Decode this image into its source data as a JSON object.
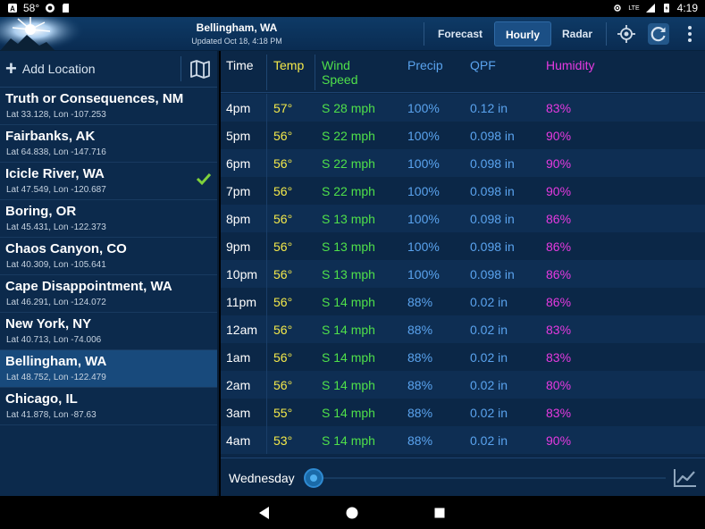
{
  "status_bar": {
    "temperature": "58°",
    "time": "4:19",
    "network": "LTE"
  },
  "header": {
    "title": "Bellingham, WA",
    "subtitle": "Updated Oct 18, 4:18 PM",
    "tabs": [
      {
        "label": "Forecast",
        "active": false
      },
      {
        "label": "Hourly",
        "active": true
      },
      {
        "label": "Radar",
        "active": false
      }
    ],
    "icons": [
      "locate-icon",
      "refresh-icon",
      "overflow-menu-icon"
    ]
  },
  "sidebar": {
    "add_label": "Add Location",
    "locations": [
      {
        "name": "Truth or Consequences, NM",
        "coords": "Lat 33.128, Lon -107.253",
        "checked": false,
        "selected": false
      },
      {
        "name": "Fairbanks, AK",
        "coords": "Lat 64.838, Lon -147.716",
        "checked": false,
        "selected": false
      },
      {
        "name": "Icicle River, WA",
        "coords": "Lat 47.549, Lon -120.687",
        "checked": true,
        "selected": false
      },
      {
        "name": "Boring, OR",
        "coords": "Lat 45.431, Lon -122.373",
        "checked": false,
        "selected": false
      },
      {
        "name": "Chaos Canyon, CO",
        "coords": "Lat 40.309, Lon -105.641",
        "checked": false,
        "selected": false
      },
      {
        "name": "Cape Disappointment, WA",
        "coords": "Lat 46.291, Lon -124.072",
        "checked": false,
        "selected": false
      },
      {
        "name": "New York, NY",
        "coords": "Lat 40.713, Lon -74.006",
        "checked": false,
        "selected": false
      },
      {
        "name": "Bellingham, WA",
        "coords": "Lat 48.752, Lon -122.479",
        "checked": false,
        "selected": true
      },
      {
        "name": "Chicago, IL",
        "coords": "Lat 41.878, Lon -87.63",
        "checked": false,
        "selected": false
      }
    ]
  },
  "table": {
    "headers": {
      "time": "Time",
      "temp": "Temp",
      "wind_line1": "Wind",
      "wind_line2": "Speed",
      "precip": "Precip",
      "qpf": "QPF",
      "humidity": "Humidity"
    },
    "rows": [
      {
        "time": "4pm",
        "temp": "57°",
        "wind": "S 28 mph",
        "precip": "100%",
        "qpf": "0.12 in",
        "humidity": "83%"
      },
      {
        "time": "5pm",
        "temp": "56°",
        "wind": "S 22 mph",
        "precip": "100%",
        "qpf": "0.098 in",
        "humidity": "90%"
      },
      {
        "time": "6pm",
        "temp": "56°",
        "wind": "S 22 mph",
        "precip": "100%",
        "qpf": "0.098 in",
        "humidity": "90%"
      },
      {
        "time": "7pm",
        "temp": "56°",
        "wind": "S 22 mph",
        "precip": "100%",
        "qpf": "0.098 in",
        "humidity": "90%"
      },
      {
        "time": "8pm",
        "temp": "56°",
        "wind": "S 13 mph",
        "precip": "100%",
        "qpf": "0.098 in",
        "humidity": "86%"
      },
      {
        "time": "9pm",
        "temp": "56°",
        "wind": "S 13 mph",
        "precip": "100%",
        "qpf": "0.098 in",
        "humidity": "86%"
      },
      {
        "time": "10pm",
        "temp": "56°",
        "wind": "S 13 mph",
        "precip": "100%",
        "qpf": "0.098 in",
        "humidity": "86%"
      },
      {
        "time": "11pm",
        "temp": "56°",
        "wind": "S 14 mph",
        "precip": "88%",
        "qpf": "0.02 in",
        "humidity": "86%"
      },
      {
        "time": "12am",
        "temp": "56°",
        "wind": "S 14 mph",
        "precip": "88%",
        "qpf": "0.02 in",
        "humidity": "83%"
      },
      {
        "time": "1am",
        "temp": "56°",
        "wind": "S 14 mph",
        "precip": "88%",
        "qpf": "0.02 in",
        "humidity": "83%"
      },
      {
        "time": "2am",
        "temp": "56°",
        "wind": "S 14 mph",
        "precip": "88%",
        "qpf": "0.02 in",
        "humidity": "80%"
      },
      {
        "time": "3am",
        "temp": "55°",
        "wind": "S 14 mph",
        "precip": "88%",
        "qpf": "0.02 in",
        "humidity": "83%"
      },
      {
        "time": "4am",
        "temp": "53°",
        "wind": "S 14 mph",
        "precip": "88%",
        "qpf": "0.02 in",
        "humidity": "90%"
      }
    ]
  },
  "footer": {
    "day_label": "Wednesday",
    "slider_value": 0
  },
  "colors": {
    "time": "#ffffff",
    "temp": "#f4e94a",
    "wind": "#4fe04a",
    "precip": "#5aa3ee",
    "humidity": "#e53ae0",
    "accent": "#184a7c"
  }
}
